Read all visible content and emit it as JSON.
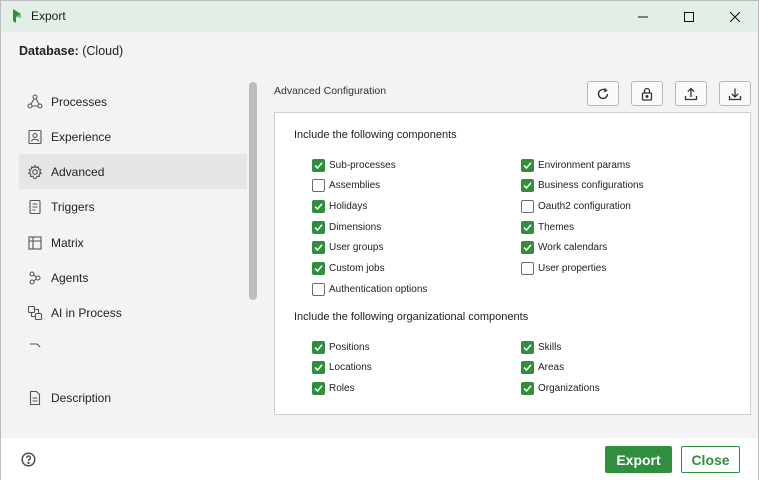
{
  "window": {
    "title": "Export",
    "controls": [
      "minimize-icon",
      "maximize-icon",
      "close-icon"
    ]
  },
  "header": {
    "database_label": "Database:",
    "database_value": "(Cloud)"
  },
  "sidebar": {
    "items": [
      {
        "label": "Processes",
        "icon": "processes-icon",
        "active": false
      },
      {
        "label": "Experience",
        "icon": "experience-icon",
        "active": false
      },
      {
        "label": "Advanced",
        "icon": "gear-icon",
        "active": true
      },
      {
        "label": "Triggers",
        "icon": "triggers-icon",
        "active": false
      },
      {
        "label": "Matrix",
        "icon": "matrix-icon",
        "active": false
      },
      {
        "label": "Agents",
        "icon": "agents-icon",
        "active": false
      },
      {
        "label": "AI in Process",
        "icon": "ai-icon",
        "active": false
      }
    ],
    "description": {
      "label": "Description",
      "icon": "document-icon"
    }
  },
  "content": {
    "section_title": "Advanced Configuration",
    "toolbar": [
      "refresh-icon",
      "lock-icon",
      "upload-icon",
      "download-icon"
    ],
    "groups": [
      {
        "title": "Include the following components",
        "left": [
          {
            "label": "Sub-processes",
            "checked": true
          },
          {
            "label": "Assemblies",
            "checked": false
          },
          {
            "label": "Holidays",
            "checked": true
          },
          {
            "label": "Dimensions",
            "checked": true
          },
          {
            "label": "User groups",
            "checked": true
          },
          {
            "label": "Custom jobs",
            "checked": true
          },
          {
            "label": "Authentication options",
            "checked": false
          }
        ],
        "right": [
          {
            "label": "Environment params",
            "checked": true
          },
          {
            "label": "Business configurations",
            "checked": true
          },
          {
            "label": "Oauth2 configuration",
            "checked": false
          },
          {
            "label": "Themes",
            "checked": true
          },
          {
            "label": "Work calendars",
            "checked": true
          },
          {
            "label": "User properties",
            "checked": false
          }
        ]
      },
      {
        "title": "Include the following organizational components",
        "left": [
          {
            "label": "Positions",
            "checked": true
          },
          {
            "label": "Locations",
            "checked": true
          },
          {
            "label": "Roles",
            "checked": true
          }
        ],
        "right": [
          {
            "label": "Skills",
            "checked": true
          },
          {
            "label": "Areas",
            "checked": true
          },
          {
            "label": "Organizations",
            "checked": true
          }
        ]
      }
    ]
  },
  "footer": {
    "help_icon": "help-icon",
    "export_label": "Export",
    "close_label": "Close"
  },
  "colors": {
    "accent": "#2f8f3f",
    "titlebar": "#e3efe6"
  }
}
